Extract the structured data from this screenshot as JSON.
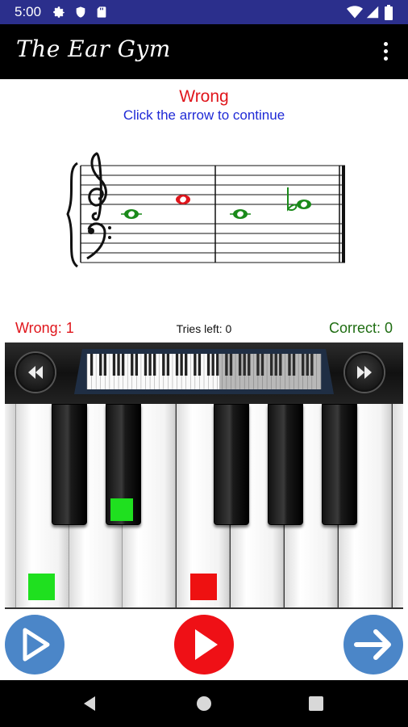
{
  "status": {
    "time": "5:00"
  },
  "app": {
    "title": "The Ear Gym"
  },
  "result": {
    "title": "Wrong",
    "subtitle": "Click the arrow to continue"
  },
  "notation": {
    "notes": [
      {
        "measure": 1,
        "pitch": "G4",
        "color": "#1a8a1a",
        "accidental": ""
      },
      {
        "measure": 1,
        "pitch": "C5",
        "color": "#e0161c",
        "accidental": ""
      },
      {
        "measure": 2,
        "pitch": "G4",
        "color": "#1a8a1a",
        "accidental": ""
      },
      {
        "measure": 2,
        "pitch": "B4",
        "color": "#1a8a1a",
        "accidental": "flat"
      }
    ]
  },
  "score": {
    "wrong": "Wrong: 1",
    "tries": "Tries left: 0",
    "correct": "Correct: 0"
  },
  "colors": {
    "wrong": "#e0161c",
    "correct": "#1f6d12",
    "accent_blue": "#4b86c8",
    "play_red": "#ef1016",
    "marker_green": "#1fe01f",
    "marker_red": "#ee1111"
  },
  "piano": {
    "markers": [
      {
        "key": "white-2",
        "color": "green"
      },
      {
        "key": "black-2",
        "color": "green"
      },
      {
        "key": "white-5",
        "color": "red"
      }
    ]
  },
  "buttons": {
    "left": "play-icon",
    "center": "play-icon",
    "right": "arrow-right-icon"
  }
}
